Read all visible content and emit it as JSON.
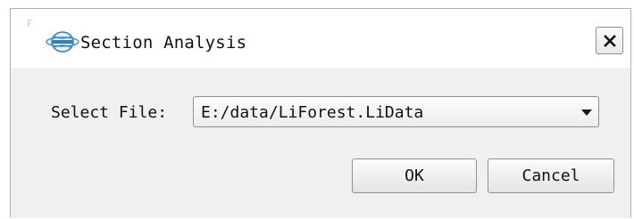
{
  "window": {
    "title": "Section Analysis",
    "faint_glyph": "F"
  },
  "icons": {
    "app_logo": "liforest-globe-logo",
    "close": "close-icon",
    "dropdown": "chevron-down-icon"
  },
  "form": {
    "file_label": "Select File:",
    "file_value": "E:/data/LiForest.LiData"
  },
  "buttons": {
    "ok_label": "OK",
    "cancel_label": "Cancel"
  },
  "colors": {
    "content_background": "#f0f0f0",
    "logo_blue": "#2f7fc4"
  }
}
